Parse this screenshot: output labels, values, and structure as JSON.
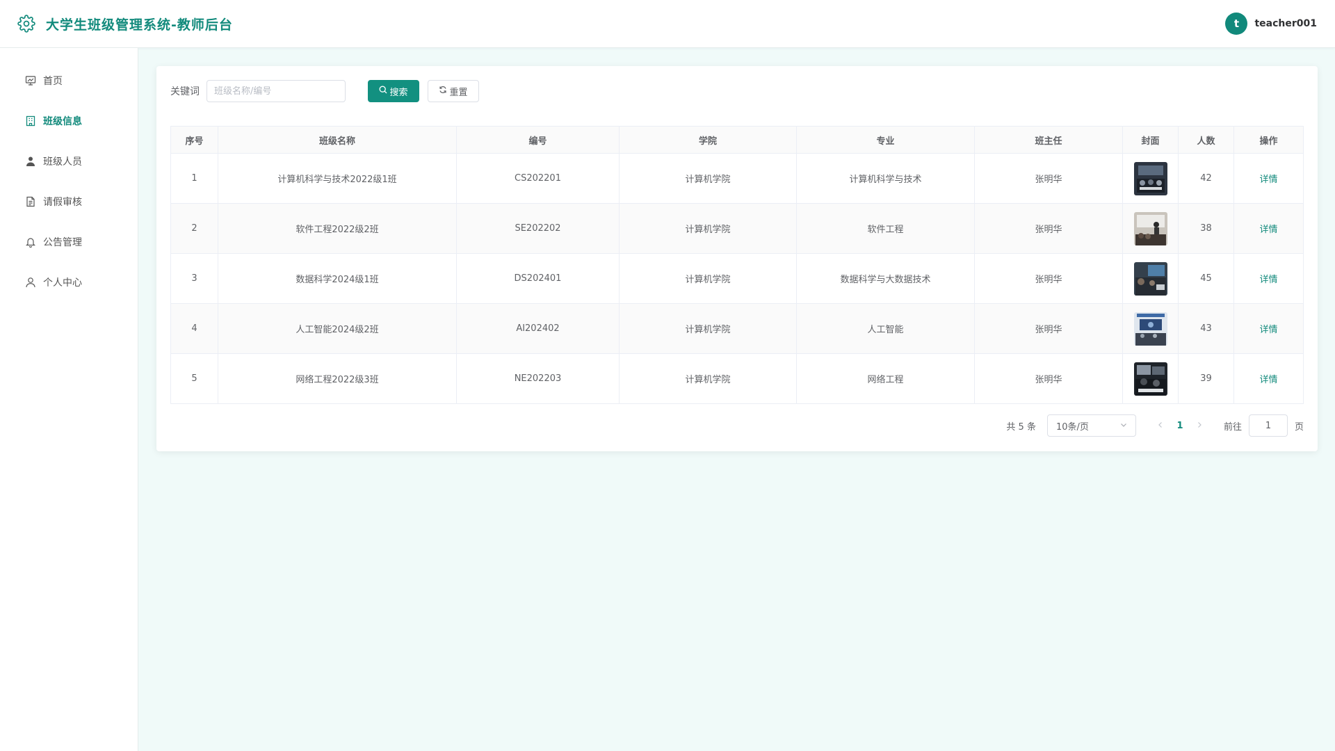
{
  "header": {
    "title": "大学生班级管理系统-教师后台",
    "brand_icon": "gear-icon",
    "avatar_letter": "t",
    "username": "teacher001"
  },
  "sidebar": {
    "items": [
      {
        "label": "首页",
        "icon": "presentation-icon",
        "active": false
      },
      {
        "label": "班级信息",
        "icon": "building-icon",
        "active": true
      },
      {
        "label": "班级人员",
        "icon": "user-icon",
        "active": false
      },
      {
        "label": "请假审核",
        "icon": "document-icon",
        "active": false
      },
      {
        "label": "公告管理",
        "icon": "bell-icon",
        "active": false
      },
      {
        "label": "个人中心",
        "icon": "person-outline-icon",
        "active": false
      }
    ]
  },
  "search": {
    "label": "关键词",
    "placeholder": "班级名称/编号",
    "value": "",
    "search_button": "搜索",
    "reset_button": "重置"
  },
  "table": {
    "columns": [
      "序号",
      "班级名称",
      "编号",
      "学院",
      "专业",
      "班主任",
      "封面",
      "人数",
      "操作"
    ],
    "rows": [
      {
        "index": "1",
        "name": "计算机科学与技术2022级1班",
        "code": "CS202201",
        "college": "计算机学院",
        "major": "计算机科学与技术",
        "teacher": "张明华",
        "count": "42",
        "action": "详情"
      },
      {
        "index": "2",
        "name": "软件工程2022级2班",
        "code": "SE202202",
        "college": "计算机学院",
        "major": "软件工程",
        "teacher": "张明华",
        "count": "38",
        "action": "详情"
      },
      {
        "index": "3",
        "name": "数据科学2024级1班",
        "code": "DS202401",
        "college": "计算机学院",
        "major": "数据科学与大数据技术",
        "teacher": "张明华",
        "count": "45",
        "action": "详情"
      },
      {
        "index": "4",
        "name": "人工智能2024级2班",
        "code": "AI202402",
        "college": "计算机学院",
        "major": "人工智能",
        "teacher": "张明华",
        "count": "43",
        "action": "详情"
      },
      {
        "index": "5",
        "name": "网络工程2022级3班",
        "code": "NE202203",
        "college": "计算机学院",
        "major": "网络工程",
        "teacher": "张明华",
        "count": "39",
        "action": "详情"
      }
    ]
  },
  "pagination": {
    "total": "共 5 条",
    "page_size": "10条/页",
    "current_page": "1",
    "goto_label": "前往",
    "goto_value": "1",
    "page_suffix": "页"
  },
  "colors": {
    "accent": "#128a7c",
    "button": "#129080",
    "background": "#f0faf9"
  }
}
